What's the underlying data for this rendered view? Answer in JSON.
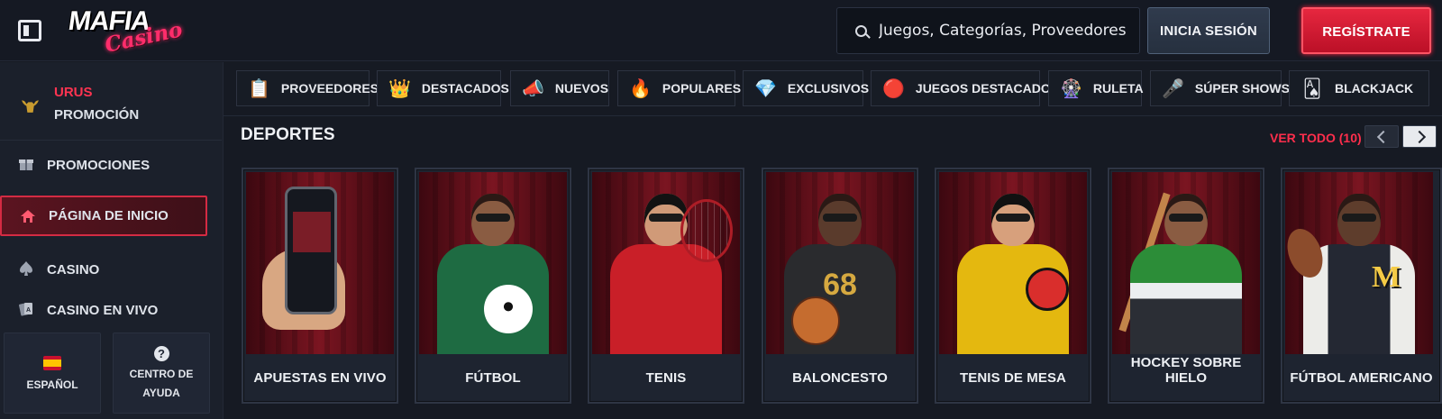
{
  "header": {
    "logo_main": "MAFIA",
    "logo_sub": "Casino",
    "search_placeholder": "Juegos, Categorías, Proveedores",
    "login_label": "INICIA SESIÓN",
    "register_label": "REGÍSTRATE"
  },
  "sidebar": {
    "promo": {
      "title": "URUS",
      "subtitle": "PROMOCIÓN"
    },
    "items": [
      {
        "label": "PROMOCIONES",
        "icon": "gift-icon",
        "active": false
      },
      {
        "label": "PÁGINA DE INICIO",
        "icon": "home-icon",
        "active": true
      },
      {
        "label": "CASINO",
        "icon": "spade-icon",
        "active": false
      },
      {
        "label": "CASINO EN VIVO",
        "icon": "cards-icon",
        "active": false
      }
    ],
    "language": "ESPAÑOL",
    "help": "CENTRO DE AYUDA"
  },
  "categories": [
    {
      "label": "PROVEEDORES",
      "icon": "providers-icon"
    },
    {
      "label": "DESTACADOS",
      "icon": "crown-icon"
    },
    {
      "label": "NUEVOS",
      "icon": "megaphone-icon"
    },
    {
      "label": "POPULARES",
      "icon": "fire-icon"
    },
    {
      "label": "EXCLUSIVOS",
      "icon": "diamond-icon"
    },
    {
      "label": "JUEGOS DESTACADOS",
      "icon": "chip-icon"
    },
    {
      "label": "RULETA",
      "icon": "roulette-icon"
    },
    {
      "label": "SÚPER SHOWS",
      "icon": "microphone-icon"
    },
    {
      "label": "BLACKJACK",
      "icon": "playing-cards-icon"
    }
  ],
  "section": {
    "title": "DEPORTES",
    "view_all": "VER TODO (10)"
  },
  "sports": [
    {
      "label": "APUESTAS EN VIVO"
    },
    {
      "label": "FÚTBOL"
    },
    {
      "label": "TENIS"
    },
    {
      "label": "BALONCESTO"
    },
    {
      "label": "TENIS DE MESA"
    },
    {
      "label": "HOCKEY SOBRE HIELO"
    },
    {
      "label": "FÚTBOL AMERICANO"
    }
  ],
  "card_art": {
    "basketball_jersey_number": "68",
    "american_football_letter": "M"
  },
  "colors": {
    "accent_red": "#e6273f",
    "background": "#161a23",
    "sidebar": "#1b202b"
  }
}
